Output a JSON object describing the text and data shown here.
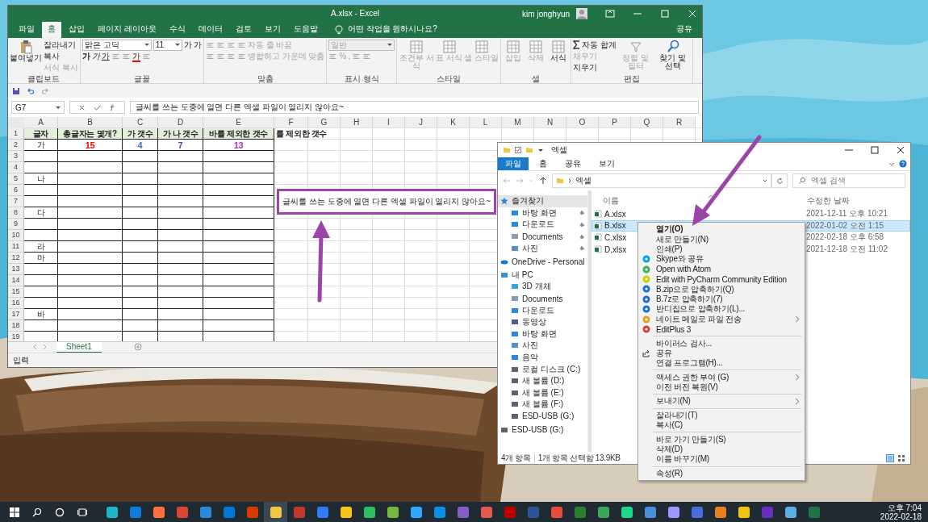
{
  "excel": {
    "title": "A.xlsx  -  Excel",
    "user": "kim jonghyun",
    "share": "공유",
    "tell_me": "어떤 작업을 원하시나요?",
    "tabs": [
      {
        "label": "파일",
        "selected": false
      },
      {
        "label": "홈",
        "selected": true
      },
      {
        "label": "삽입",
        "selected": false
      },
      {
        "label": "페이지 레이아웃",
        "selected": false
      },
      {
        "label": "수식",
        "selected": false
      },
      {
        "label": "데이터",
        "selected": false
      },
      {
        "label": "검토",
        "selected": false
      },
      {
        "label": "보기",
        "selected": false
      },
      {
        "label": "도움말",
        "selected": false
      }
    ],
    "ribbon": [
      {
        "label": "클립보드",
        "items": [
          {
            "kind": "paste",
            "label": "붙여넣기",
            "disabled": false
          },
          {
            "kind": "stack",
            "lines": [
              [
                {
                  "kind": "button",
                  "label": "잘라내기",
                  "disabled": false
                }
              ],
              [
                {
                  "kind": "button",
                  "label": "복사",
                  "disabled": false
                }
              ],
              [
                {
                  "kind": "button",
                  "label": "서식 복사",
                  "disabled": true
                }
              ]
            ]
          }
        ]
      },
      {
        "label": "글꼴",
        "items": [
          {
            "kind": "stack",
            "lines": [
              [
                {
                  "kind": "field-wide",
                  "value": "맑은 고딕"
                },
                {
                  "kind": "field-narrow",
                  "value": "11"
                },
                {
                  "kind": "button",
                  "label": "가",
                  "disabled": false
                },
                {
                  "kind": "button",
                  "label": "가",
                  "disabled": false
                }
              ],
              [
                {
                  "kind": "button",
                  "label": "가",
                  "disabled": false
                },
                {
                  "kind": "button",
                  "label": "가",
                  "disabled": false
                },
                {
                  "kind": "button",
                  "label": "가",
                  "disabled": false
                },
                {
                  "kind": "icon"
                },
                {
                  "kind": "icon"
                },
                {
                  "kind": "button",
                  "label": "가",
                  "color": "#ff0000",
                  "disabled": false
                },
                {
                  "kind": "icon"
                }
              ]
            ]
          }
        ]
      },
      {
        "label": "맞춤",
        "items": [
          {
            "kind": "stack",
            "lines": [
              [
                {
                  "kind": "icon"
                },
                {
                  "kind": "icon"
                },
                {
                  "kind": "icon"
                },
                {
                  "kind": "icon"
                },
                {
                  "kind": "button",
                  "label": "자동 줄 바꿈",
                  "disabled": true
                }
              ],
              [
                {
                  "kind": "icon"
                },
                {
                  "kind": "icon"
                },
                {
                  "kind": "icon"
                },
                {
                  "kind": "icon"
                },
                {
                  "kind": "button",
                  "label": "병합하고 가운데 맞춤",
                  "disabled": true
                }
              ]
            ]
          }
        ]
      },
      {
        "label": "표시 형식",
        "items": [
          {
            "kind": "stack",
            "lines": [
              [
                {
                  "kind": "field-number",
                  "value": "일반"
                }
              ],
              [
                {
                  "kind": "icon"
                },
                {
                  "kind": "button",
                  "label": "%",
                  "disabled": true
                },
                {
                  "kind": "button",
                  "label": ",",
                  "disabled": true
                },
                {
                  "kind": "icon"
                },
                {
                  "kind": "icon"
                }
              ]
            ]
          }
        ]
      },
      {
        "label": "스타일",
        "items": [
          {
            "kind": "grid",
            "label": "조건부 서식",
            "disabled": true
          },
          {
            "kind": "grid",
            "label": "표 서식",
            "disabled": true
          },
          {
            "kind": "grid",
            "label": "셀 스타일",
            "disabled": true
          }
        ]
      },
      {
        "label": "셀",
        "items": [
          {
            "kind": "grid",
            "label": "삽입",
            "disabled": true
          },
          {
            "kind": "grid",
            "label": "삭제",
            "disabled": true
          },
          {
            "kind": "grid",
            "label": "서식",
            "disabled": false
          }
        ]
      },
      {
        "label": "편집",
        "items": [
          {
            "kind": "stack",
            "lines": [
              [
                {
                  "kind": "sum",
                  "label": "자동 합계",
                  "disabled": false
                }
              ],
              [
                {
                  "kind": "button",
                  "label": "채우기",
                  "disabled": true
                }
              ],
              [
                {
                  "kind": "button",
                  "label": "지우기",
                  "disabled": false
                }
              ]
            ]
          },
          {
            "kind": "sort",
            "label": "정렬 및 필터",
            "disabled": true
          },
          {
            "kind": "search",
            "label": "찾기 및 선택",
            "disabled": false
          }
        ]
      }
    ],
    "name_box": "G7",
    "formula": "글씨를 쓰는 도중에 열면 다른 엑셀 파일이 열리지 않아요~",
    "columns": [
      "A",
      "B",
      "C",
      "D",
      "E",
      "F",
      "G",
      "H",
      "I",
      "J",
      "K",
      "L",
      "M",
      "N",
      "O",
      "P",
      "Q",
      "R"
    ],
    "rows": [
      {
        "number": "1",
        "kind": "header",
        "cells": [
          {
            "text": "글자"
          },
          {
            "text": "총글자는 몇개?"
          },
          {
            "text": "가 갯수"
          },
          {
            "text": "가 나 갯수"
          },
          {
            "text": "바를 제외한 갯수"
          },
          {
            "text": "를 제외한 갯수"
          }
        ]
      },
      {
        "number": "2",
        "kind": "data",
        "cells": [
          {
            "text": "가"
          },
          {
            "text": "15",
            "color": "#ff0000"
          },
          {
            "text": "4",
            "color": "#4472c4"
          },
          {
            "text": "7",
            "color": "#7030a0"
          },
          {
            "text": "13",
            "color": "#b02fc0"
          }
        ]
      },
      {
        "number": "3",
        "kind": "data"
      },
      {
        "number": "4",
        "kind": "data"
      },
      {
        "number": "5",
        "kind": "data",
        "cells": [
          {
            "text": "나"
          }
        ]
      },
      {
        "number": "6",
        "kind": "data"
      },
      {
        "number": "7",
        "kind": "data"
      },
      {
        "number": "8",
        "kind": "data",
        "cells": [
          {
            "text": "다"
          }
        ]
      },
      {
        "number": "9",
        "kind": "data"
      },
      {
        "number": "10",
        "kind": "data"
      },
      {
        "number": "11",
        "kind": "data",
        "cells": [
          {
            "text": "라"
          }
        ]
      },
      {
        "number": "12",
        "kind": "data",
        "cells": [
          {
            "text": "마"
          }
        ]
      },
      {
        "number": "13",
        "kind": "data"
      },
      {
        "number": "14",
        "kind": "data"
      },
      {
        "number": "15",
        "kind": "data"
      },
      {
        "number": "16",
        "kind": "data"
      },
      {
        "number": "17",
        "kind": "data",
        "cells": [
          {
            "text": "바"
          }
        ]
      },
      {
        "number": "18",
        "kind": "data"
      },
      {
        "number": "19",
        "kind": "data"
      }
    ],
    "cell_edit": {
      "text": "글씨를 쓰는 도중에 열면 다른 엑셀 파일이 열리지 않아요~",
      "color": "#9c45a8"
    },
    "sheet_tabs": [
      {
        "label": "Sheet1",
        "selected": true
      }
    ],
    "status": "입력"
  },
  "arrows": [
    {
      "color": "#9c45a8"
    },
    {
      "color": "#9c45a8"
    }
  ],
  "explorer": {
    "title": "엑셀",
    "tabs": [
      {
        "label": "파일",
        "selected": true
      },
      {
        "label": "홈",
        "selected": false
      },
      {
        "label": "공유",
        "selected": false
      },
      {
        "label": "보기",
        "selected": false
      }
    ],
    "path": "엑셀",
    "search_placeholder": "엑셀 검색",
    "nav": [
      {
        "label": "즐겨찾기",
        "kind": "star",
        "selected": true,
        "children": [
          {
            "label": "바탕 화면",
            "kind": "desktop",
            "pinned": true
          },
          {
            "label": "다운로드",
            "kind": "download",
            "pinned": true
          },
          {
            "label": "Documents",
            "kind": "document",
            "pinned": true
          },
          {
            "label": "사진",
            "kind": "picture",
            "pinned": true
          }
        ]
      },
      {
        "label": "OneDrive - Personal",
        "kind": "cloud",
        "selected": false
      },
      {
        "label": "내 PC",
        "kind": "pc",
        "selected": false,
        "children": [
          {
            "label": "3D 개체",
            "kind": "cube",
            "pinned": false
          },
          {
            "label": "Documents",
            "kind": "document",
            "pinned": false
          },
          {
            "label": "다운로드",
            "kind": "download",
            "pinned": false
          },
          {
            "label": "동영상",
            "kind": "video",
            "pinned": false
          },
          {
            "label": "바탕 화면",
            "kind": "desktop",
            "pinned": false
          },
          {
            "label": "사진",
            "kind": "picture",
            "pinned": false
          },
          {
            "label": "음악",
            "kind": "music",
            "pinned": false
          },
          {
            "label": "로컬 디스크 (C:)",
            "kind": "disk",
            "pinned": false
          },
          {
            "label": "새 볼륨 (D:)",
            "kind": "drive",
            "pinned": false
          },
          {
            "label": "새 볼륨 (E:)",
            "kind": "drive",
            "pinned": false
          },
          {
            "label": "새 볼륨 (F:)",
            "kind": "drive",
            "pinned": false
          },
          {
            "label": "ESD-USB (G:)",
            "kind": "drive",
            "pinned": false
          }
        ]
      },
      {
        "label": "ESD-USB (G:)",
        "kind": "drive",
        "selected": false
      }
    ],
    "columns": [
      "이름",
      "수정한 날짜"
    ],
    "files": [
      {
        "name": "A.xlsx",
        "modified": "2021-12-11 오후 10:21",
        "selected": false
      },
      {
        "name": "B.xlsx",
        "modified": "2022-01-02 오전 1:15",
        "selected": true
      },
      {
        "name": "C.xlsx",
        "modified": "2022-02-18 오후 6:58",
        "selected": false
      },
      {
        "name": "D.xlsx",
        "modified": "2021-12-18 오전 11:02",
        "selected": false
      }
    ],
    "status": [
      "4개 항목",
      "1개 항목 선택함 13.9KB"
    ]
  },
  "context_menu": [
    {
      "kind": "plain",
      "label": "열기(O)",
      "default": true
    },
    {
      "kind": "plain",
      "label": "새로 만들기(N)",
      "default": false
    },
    {
      "kind": "plain",
      "label": "인쇄(P)",
      "default": false
    },
    {
      "kind": "skype",
      "label": "Skype와 공유",
      "default": false
    },
    {
      "kind": "atom",
      "label": "Open with Atom",
      "default": false
    },
    {
      "kind": "pycharm",
      "label": "Edit with PyCharm Community Edition",
      "default": false
    },
    {
      "kind": "zip",
      "label": "B.zip으로 압축하기(Q)",
      "default": false
    },
    {
      "kind": "zip",
      "label": "B.7z로 압축하기(7)",
      "default": false
    },
    {
      "kind": "zip",
      "label": "반디집으로 압축하기(L)...",
      "default": false
    },
    {
      "kind": "mail",
      "label": "네이트 메일로 파일 전송",
      "default": false,
      "submenu": true
    },
    {
      "kind": "editplus",
      "label": "EditPlus 3",
      "default": false
    },
    {
      "kind": "separator"
    },
    {
      "kind": "plain",
      "label": "바이러스 검사...",
      "default": false
    },
    {
      "kind": "share",
      "label": "공유",
      "default": false
    },
    {
      "kind": "plain",
      "label": "연결 프로그램(H)...",
      "default": false
    },
    {
      "kind": "separator"
    },
    {
      "kind": "plain",
      "label": "액세스 권한 부여 (G)",
      "default": false,
      "submenu": true
    },
    {
      "kind": "plain",
      "label": "이전 버전 복원(V)",
      "default": false
    },
    {
      "kind": "separator"
    },
    {
      "kind": "plain",
      "label": "보내기(N)",
      "default": false,
      "submenu": true
    },
    {
      "kind": "separator"
    },
    {
      "kind": "plain",
      "label": "잘라내기(T)",
      "default": false
    },
    {
      "kind": "plain",
      "label": "복사(C)",
      "default": false
    },
    {
      "kind": "separator"
    },
    {
      "kind": "plain",
      "label": "바로 가기 만들기(S)",
      "default": false
    },
    {
      "kind": "plain",
      "label": "삭제(D)",
      "default": false
    },
    {
      "kind": "plain",
      "label": "이름 바꾸기(M)",
      "default": false
    },
    {
      "kind": "separator"
    },
    {
      "kind": "plain",
      "label": "속성(R)",
      "default": false
    }
  ],
  "taskbar": {
    "apps": [
      {
        "color": "#1fb5c9",
        "selected": false
      },
      {
        "color": "#0f7bd8",
        "selected": false
      },
      {
        "color": "#ff7139",
        "selected": false
      },
      {
        "color": "#db4437",
        "selected": false
      },
      {
        "color": "#2b88d8",
        "selected": false
      },
      {
        "color": "#0078d4",
        "selected": false
      },
      {
        "color": "#d83b01",
        "selected": false
      },
      {
        "color": "#f2c744",
        "selected": true
      },
      {
        "color": "#c0392b",
        "selected": false
      },
      {
        "color": "#2d7df6",
        "selected": false
      },
      {
        "color": "#f5c518",
        "selected": false
      },
      {
        "color": "#2dbe60",
        "selected": false
      },
      {
        "color": "#76b83f",
        "selected": false
      },
      {
        "color": "#31a8ff",
        "selected": false
      },
      {
        "color": "#0e8ee9",
        "selected": false
      },
      {
        "color": "#865fc5",
        "selected": false
      },
      {
        "color": "#e05a4e",
        "selected": false
      },
      {
        "color": "#bf0000",
        "selected": false
      },
      {
        "color": "#2b5797",
        "selected": false
      },
      {
        "color": "#e74c3c",
        "selected": false
      },
      {
        "color": "#2e7d32",
        "selected": false
      },
      {
        "color": "#3aa657",
        "selected": false
      },
      {
        "color": "#21d789",
        "selected": false
      },
      {
        "color": "#4a90d9",
        "selected": false
      },
      {
        "color": "#9999ff",
        "selected": false
      },
      {
        "color": "#4a6ee0",
        "selected": false
      },
      {
        "color": "#e67e22",
        "selected": false
      },
      {
        "color": "#f1c40f",
        "selected": false
      },
      {
        "color": "#6b2fbf",
        "selected": false
      },
      {
        "color": "#5dade2",
        "selected": false
      },
      {
        "color": "#217346",
        "selected": false
      }
    ],
    "time": "오후 7:04",
    "date": "2022-02-18"
  }
}
